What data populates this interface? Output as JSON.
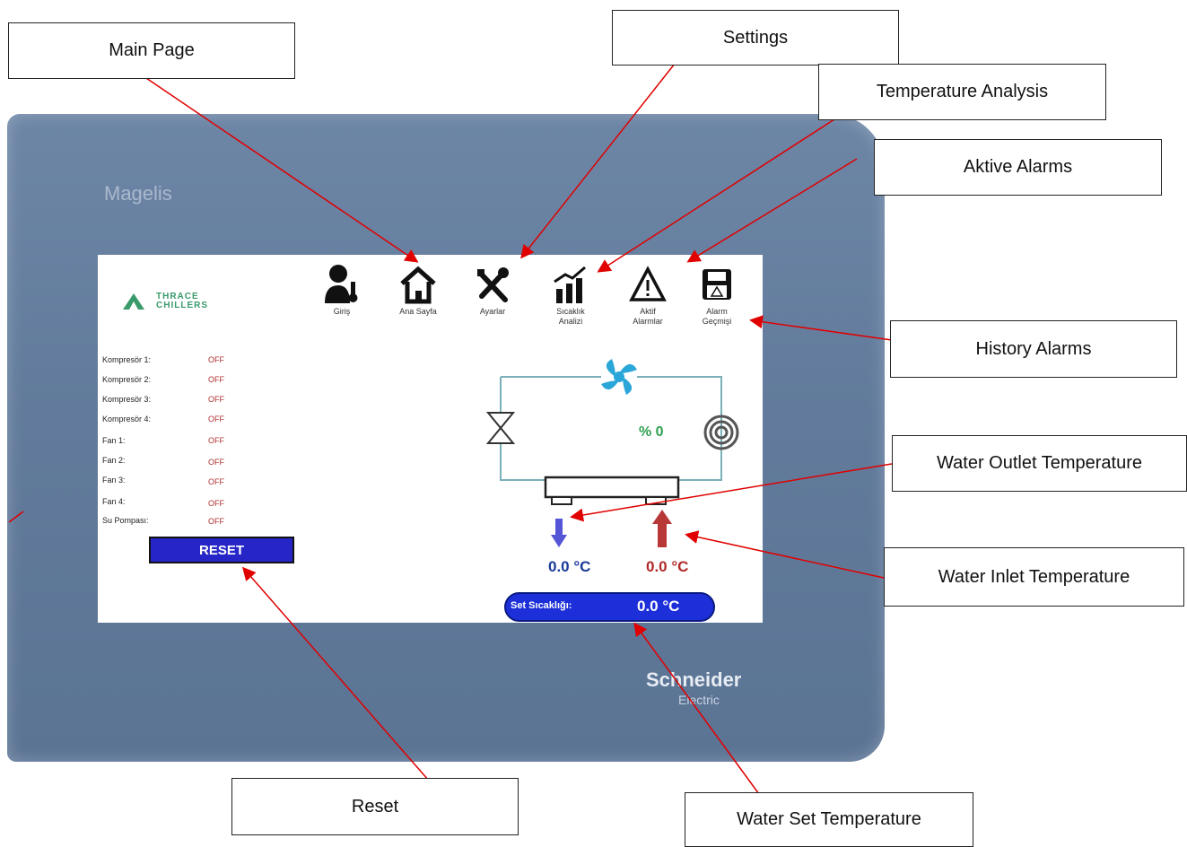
{
  "device": {
    "brand_top": "Magelis",
    "brand_bottom": "Schneider",
    "brand_bottom_sub": "Electric"
  },
  "logo": {
    "line1": "THRACE",
    "line2": "CHILLERS"
  },
  "nav": [
    {
      "label": "Giriş",
      "icon": "user-icon"
    },
    {
      "label": "Ana Sayfa",
      "icon": "home-icon"
    },
    {
      "label": "Ayarlar",
      "icon": "tools-icon"
    },
    {
      "label_line1": "Sıcaklık",
      "label_line2": "Analizi",
      "icon": "chart-icon"
    },
    {
      "label_line1": "Aktif",
      "label_line2": "Alarmlar",
      "icon": "warning-icon"
    },
    {
      "label_line1": "Alarm",
      "label_line2": "Geçmişi",
      "icon": "floppy-icon"
    }
  ],
  "status": [
    {
      "name": "Kompresör 1:",
      "value": "OFF"
    },
    {
      "name": "Kompresör 2:",
      "value": "OFF"
    },
    {
      "name": "Kompresör 3:",
      "value": "OFF"
    },
    {
      "name": "Kompresör 4:",
      "value": "OFF"
    },
    {
      "name": "Fan 1:",
      "value": "OFF"
    },
    {
      "name": "Fan 2:",
      "value": "OFF"
    },
    {
      "name": "Fan 3:",
      "value": "OFF"
    },
    {
      "name": "Fan 4:",
      "value": "OFF"
    },
    {
      "name": "Su Pompası:",
      "value": "OFF"
    }
  ],
  "reset_label": "RESET",
  "process": {
    "percent": "% 0",
    "outlet_temp": "0.0 °C",
    "inlet_temp": "0.0 °C"
  },
  "setpoint": {
    "label": "Set Sıcaklığı:",
    "value": "0.0 °C"
  },
  "callouts": {
    "main_page": "Main Page",
    "settings": "Settings",
    "temperature_analysis": "Temperature Analysis",
    "active_alarms": "Aktive Alarms",
    "history_alarms": "History Alarms",
    "water_outlet": "Water Outlet Temperature",
    "water_inlet": "Water Inlet Temperature",
    "reset": "Reset",
    "water_set": "Water Set Temperature"
  },
  "colors": {
    "bezel": "#627b9c",
    "reset_button": "#2626c8",
    "setpoint_pill": "#1c2fd8",
    "off_text": "#b03030",
    "arrow": "#e00000"
  }
}
